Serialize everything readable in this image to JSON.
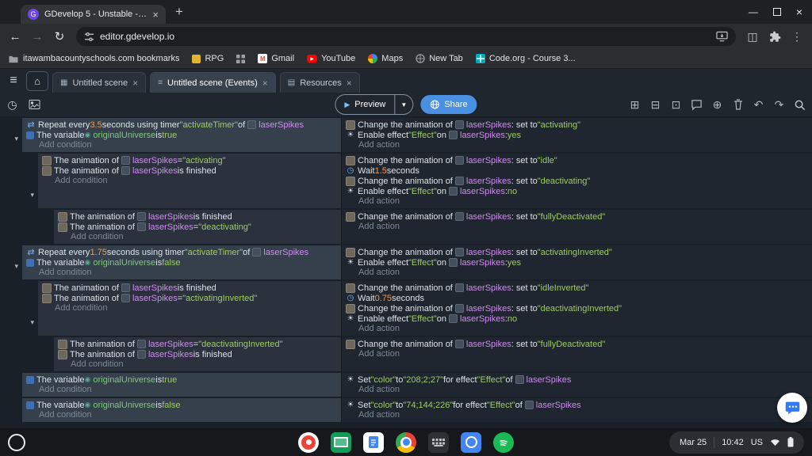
{
  "chrome": {
    "tab_title": "GDevelop 5 - Unstable - GDevel...",
    "url": "editor.gdevelop.io",
    "bookmarks": [
      {
        "icon": "folder",
        "label": "itawambacountyschools.com bookmarks"
      },
      {
        "icon": "rpg",
        "label": "RPG"
      },
      {
        "icon": "grid",
        "label": ""
      },
      {
        "icon": "gmail",
        "label": "Gmail"
      },
      {
        "icon": "youtube",
        "label": "YouTube"
      },
      {
        "icon": "maps",
        "label": "Maps"
      },
      {
        "icon": "newtab",
        "label": "New Tab"
      },
      {
        "icon": "codeorg",
        "label": "Code.org - Course 3..."
      }
    ]
  },
  "gdevelop": {
    "tabs": [
      {
        "icon": "scene",
        "label": "Untitled scene",
        "active": false
      },
      {
        "icon": "events",
        "label": "Untitled scene (Events)",
        "active": true
      },
      {
        "icon": "resources",
        "label": "Resources",
        "active": false
      }
    ],
    "toolbar": {
      "preview_label": "Preview",
      "share_label": "Share",
      "right_icons": [
        "add-event",
        "add-subevent",
        "add-other-event",
        "comment",
        "add-circle",
        "trash",
        "undo",
        "redo",
        "search"
      ]
    }
  },
  "labels": {
    "add_condition": "Add condition",
    "add_action": "Add action"
  },
  "colors": {
    "accent_blue": "#4a90e2",
    "object": "#d08bf0",
    "string": "#9ccc65",
    "number": "#f09a4e"
  },
  "events": [
    {
      "indent": 0,
      "caret": true,
      "conditions": [
        [
          [
            "ic",
            "repeat"
          ],
          [
            "tx",
            "Repeat every "
          ],
          [
            "num",
            "3.5"
          ],
          [
            "tx",
            " seconds using timer "
          ],
          [
            "str",
            "\"activateTimer\""
          ],
          [
            "tx",
            " of "
          ],
          [
            "obj",
            "laserSpikes"
          ]
        ],
        [
          [
            "ic",
            "variable"
          ],
          [
            "tx",
            "The variable "
          ],
          [
            "var",
            "originalUniverse"
          ],
          [
            "tx",
            " is "
          ],
          [
            "bool",
            "true"
          ]
        ]
      ],
      "actions": [
        [
          [
            "ic",
            "animation"
          ],
          [
            "tx",
            "Change the animation of "
          ],
          [
            "obj",
            "laserSpikes"
          ],
          [
            "tx",
            ": set to "
          ],
          [
            "str",
            "\"activating\""
          ]
        ],
        [
          [
            "ic",
            "effect"
          ],
          [
            "tx",
            "Enable effect "
          ],
          [
            "str",
            "\"Effect\""
          ],
          [
            "tx",
            " on "
          ],
          [
            "obj",
            "laserSpikes"
          ],
          [
            "tx",
            ": "
          ],
          [
            "bool",
            "yes"
          ]
        ]
      ]
    },
    {
      "indent": 1,
      "caret": true,
      "conditions": [
        [
          [
            "ic",
            "animation"
          ],
          [
            "tx",
            "The animation of "
          ],
          [
            "obj",
            "laserSpikes"
          ],
          [
            "tx",
            " = "
          ],
          [
            "str",
            "\"activating\""
          ]
        ],
        [
          [
            "ic",
            "animation"
          ],
          [
            "tx",
            "The animation of "
          ],
          [
            "obj",
            "laserSpikes"
          ],
          [
            "tx",
            " is finished"
          ]
        ]
      ],
      "actions": [
        [
          [
            "ic",
            "animation"
          ],
          [
            "tx",
            "Change the animation of "
          ],
          [
            "obj",
            "laserSpikes"
          ],
          [
            "tx",
            ": set to "
          ],
          [
            "str",
            "\"idle\""
          ]
        ],
        [
          [
            "ic",
            "wait"
          ],
          [
            "tx",
            "Wait "
          ],
          [
            "num",
            "1.5"
          ],
          [
            "tx",
            " seconds"
          ]
        ],
        [
          [
            "ic",
            "animation"
          ],
          [
            "tx",
            "Change the animation of "
          ],
          [
            "obj",
            "laserSpikes"
          ],
          [
            "tx",
            ": set to "
          ],
          [
            "str",
            "\"deactivating\""
          ]
        ],
        [
          [
            "ic",
            "effect"
          ],
          [
            "tx",
            "Enable effect "
          ],
          [
            "str",
            "\"Effect\""
          ],
          [
            "tx",
            " on "
          ],
          [
            "obj",
            "laserSpikes"
          ],
          [
            "tx",
            ": "
          ],
          [
            "bool",
            "no"
          ]
        ]
      ]
    },
    {
      "indent": 2,
      "caret": false,
      "conditions": [
        [
          [
            "ic",
            "animation"
          ],
          [
            "tx",
            "The animation of "
          ],
          [
            "obj",
            "laserSpikes"
          ],
          [
            "tx",
            " is finished"
          ]
        ],
        [
          [
            "ic",
            "animation"
          ],
          [
            "tx",
            "The animation of "
          ],
          [
            "obj",
            "laserSpikes"
          ],
          [
            "tx",
            " = "
          ],
          [
            "str",
            "\"deactivating\""
          ]
        ]
      ],
      "actions": [
        [
          [
            "ic",
            "animation"
          ],
          [
            "tx",
            "Change the animation of "
          ],
          [
            "obj",
            "laserSpikes"
          ],
          [
            "tx",
            ": set to "
          ],
          [
            "str",
            "\"fullyDeactivated\""
          ]
        ]
      ]
    },
    {
      "indent": 0,
      "caret": true,
      "conditions": [
        [
          [
            "ic",
            "repeat"
          ],
          [
            "tx",
            "Repeat every "
          ],
          [
            "num",
            "1.75"
          ],
          [
            "tx",
            " seconds using timer "
          ],
          [
            "str",
            "\"activateTimer\""
          ],
          [
            "tx",
            " of "
          ],
          [
            "obj",
            "laserSpikes"
          ]
        ],
        [
          [
            "ic",
            "variable"
          ],
          [
            "tx",
            "The variable "
          ],
          [
            "var",
            "originalUniverse"
          ],
          [
            "tx",
            " is "
          ],
          [
            "bool",
            "false"
          ]
        ]
      ],
      "actions": [
        [
          [
            "ic",
            "animation"
          ],
          [
            "tx",
            "Change the animation of "
          ],
          [
            "obj",
            "laserSpikes"
          ],
          [
            "tx",
            ": set to "
          ],
          [
            "str",
            "\"activatingInverted\""
          ]
        ],
        [
          [
            "ic",
            "effect"
          ],
          [
            "tx",
            "Enable effect "
          ],
          [
            "str",
            "\"Effect\""
          ],
          [
            "tx",
            " on "
          ],
          [
            "obj",
            "laserSpikes"
          ],
          [
            "tx",
            ": "
          ],
          [
            "bool",
            "yes"
          ]
        ]
      ]
    },
    {
      "indent": 1,
      "caret": true,
      "conditions": [
        [
          [
            "ic",
            "animation"
          ],
          [
            "tx",
            "The animation of "
          ],
          [
            "obj",
            "laserSpikes"
          ],
          [
            "tx",
            " is finished"
          ]
        ],
        [
          [
            "ic",
            "animation"
          ],
          [
            "tx",
            "The animation of "
          ],
          [
            "obj",
            "laserSpikes"
          ],
          [
            "tx",
            " = "
          ],
          [
            "str",
            "\"activatingInverted\""
          ]
        ]
      ],
      "actions": [
        [
          [
            "ic",
            "animation"
          ],
          [
            "tx",
            "Change the animation of "
          ],
          [
            "obj",
            "laserSpikes"
          ],
          [
            "tx",
            ": set to "
          ],
          [
            "str",
            "\"idleInverted\""
          ]
        ],
        [
          [
            "ic",
            "wait"
          ],
          [
            "tx",
            "Wait "
          ],
          [
            "num",
            "0.75"
          ],
          [
            "tx",
            " seconds"
          ]
        ],
        [
          [
            "ic",
            "animation"
          ],
          [
            "tx",
            "Change the animation of "
          ],
          [
            "obj",
            "laserSpikes"
          ],
          [
            "tx",
            ": set to "
          ],
          [
            "str",
            "\"deactivatingInverted\""
          ]
        ],
        [
          [
            "ic",
            "effect"
          ],
          [
            "tx",
            "Enable effect "
          ],
          [
            "str",
            "\"Effect\""
          ],
          [
            "tx",
            " on "
          ],
          [
            "obj",
            "laserSpikes"
          ],
          [
            "tx",
            ": "
          ],
          [
            "bool",
            "no"
          ]
        ]
      ]
    },
    {
      "indent": 2,
      "caret": false,
      "conditions": [
        [
          [
            "ic",
            "animation"
          ],
          [
            "tx",
            "The animation of "
          ],
          [
            "obj",
            "laserSpikes"
          ],
          [
            "tx",
            " = "
          ],
          [
            "str",
            "\"deactivatingInverted\""
          ]
        ],
        [
          [
            "ic",
            "animation"
          ],
          [
            "tx",
            "The animation of "
          ],
          [
            "obj",
            "laserSpikes"
          ],
          [
            "tx",
            " is finished"
          ]
        ]
      ],
      "actions": [
        [
          [
            "ic",
            "animation"
          ],
          [
            "tx",
            "Change the animation of "
          ],
          [
            "obj",
            "laserSpikes"
          ],
          [
            "tx",
            ": set to "
          ],
          [
            "str",
            "\"fullyDeactivated\""
          ]
        ]
      ]
    },
    {
      "indent": 0,
      "caret": false,
      "conditions": [
        [
          [
            "ic",
            "variable"
          ],
          [
            "tx",
            "The variable "
          ],
          [
            "var",
            "originalUniverse"
          ],
          [
            "tx",
            " is "
          ],
          [
            "bool",
            "true"
          ]
        ]
      ],
      "actions": [
        [
          [
            "ic",
            "effect"
          ],
          [
            "tx",
            "Set "
          ],
          [
            "str",
            "\"color\""
          ],
          [
            "tx",
            " to "
          ],
          [
            "str",
            "\"208;2;27\""
          ],
          [
            "tx",
            " for effect "
          ],
          [
            "str",
            "\"Effect\""
          ],
          [
            "tx",
            " of "
          ],
          [
            "obj",
            "laserSpikes"
          ]
        ]
      ]
    },
    {
      "indent": 0,
      "caret": false,
      "conditions": [
        [
          [
            "ic",
            "variable"
          ],
          [
            "tx",
            "The variable "
          ],
          [
            "var",
            "originalUniverse"
          ],
          [
            "tx",
            " is "
          ],
          [
            "bool",
            "false"
          ]
        ]
      ],
      "actions": [
        [
          [
            "ic",
            "effect"
          ],
          [
            "tx",
            "Set "
          ],
          [
            "str",
            "\"color\""
          ],
          [
            "tx",
            " to "
          ],
          [
            "str",
            "\"74;144;226\""
          ],
          [
            "tx",
            " for effect "
          ],
          [
            "str",
            "\"Effect\""
          ],
          [
            "tx",
            " of "
          ],
          [
            "obj",
            "laserSpikes"
          ]
        ]
      ]
    }
  ],
  "shelf": {
    "date": "Mar 25",
    "time": "10:42",
    "input_lang": "US",
    "apps": [
      "screen-record",
      "classroom",
      "docs",
      "chrome",
      "keyboard",
      "camera",
      "spotify"
    ]
  }
}
